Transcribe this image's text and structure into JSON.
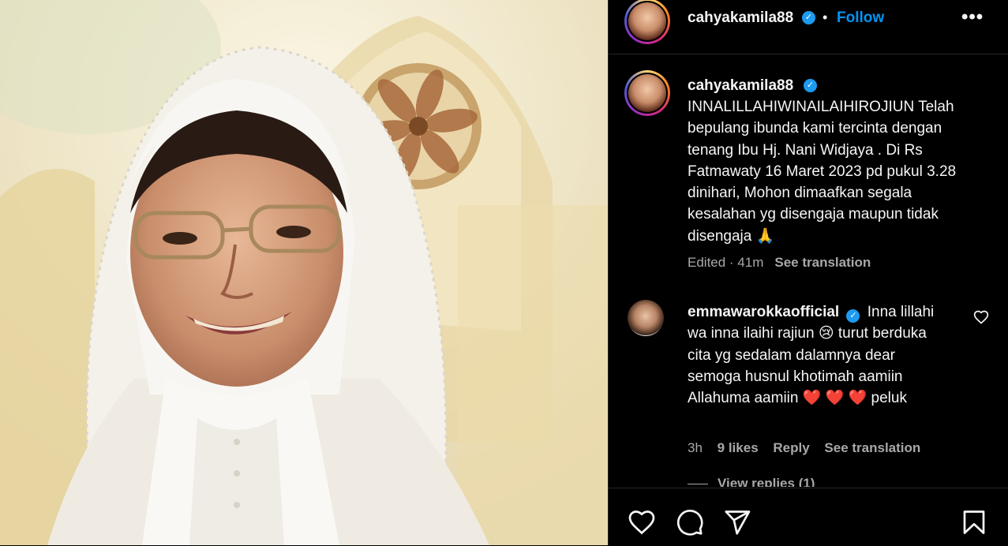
{
  "post": {
    "username": "cahyakamila88",
    "follow_label": "Follow",
    "separator": "•",
    "more_label": "•••"
  },
  "caption": {
    "username": "cahyakamila88",
    "text": "INNALILLAHIWINAILAIHIROJIUN Telah bepulang ibunda kami tercinta dengan tenang Ibu Hj. Nani Widjaya . Di Rs Fatmawaty 16 Maret 2023 pd pukul 3.28 dinihari, Mohon dimaafkan segala kesalahan yg disengaja maupun tidak disengaja 🙏",
    "meta": "Edited · 41m",
    "see_translation": "See translation"
  },
  "comment": {
    "username": "emmawarokkaofficial",
    "text": "Inna lillahi wa inna ilaihi rajiun 😢 turut berduka cita yg sedalam dalamnya dear semoga husnul khotimah aamiin Allahuma aamiin ❤️ ❤️ ❤️ peluk",
    "time": "3h",
    "likes": "9 likes",
    "reply_label": "Reply",
    "see_translation": "See translation",
    "view_replies": "View replies (1)"
  },
  "icons": {
    "verified": "verified-badge-icon",
    "like": "heart-icon",
    "comment": "comment-bubble-icon",
    "share": "paper-plane-icon",
    "save": "bookmark-icon",
    "comment_like": "heart-icon"
  },
  "colors": {
    "background": "#000000",
    "text": "#f5f5f5",
    "muted": "#a8a8a8",
    "link": "#0095f6",
    "verified": "#1d9bf0",
    "divider": "#262626"
  }
}
